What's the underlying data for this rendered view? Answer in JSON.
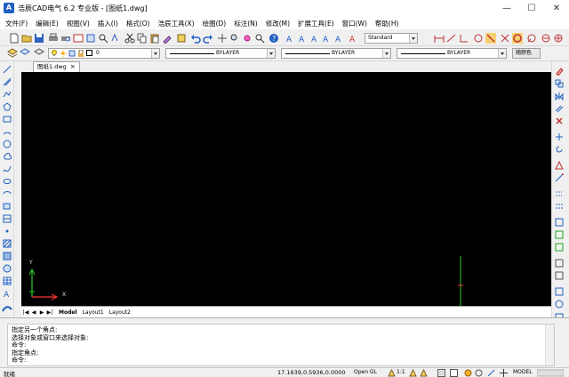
{
  "window": {
    "app_icon_label": "A",
    "title": "浩辰CAD电气 6.2 专业版 - [图纸1.dwg]",
    "minimize": "—",
    "maximize": "☐",
    "close": "✕"
  },
  "menu": [
    "文件(F)",
    "编辑(E)",
    "视图(V)",
    "插入(I)",
    "格式(O)",
    "浩辰工具(X)",
    "绘图(D)",
    "标注(N)",
    "修改(M)",
    "扩展工具(E)",
    "窗口(W)",
    "帮助(H)"
  ],
  "toolbar": {
    "text_style_value": "Standard",
    "layer_value": "0",
    "linetype_value": "BYLAYER",
    "lineweight_value": "BYLAYER",
    "color_value": "BYLAYER",
    "plot_style_value": "随颜色"
  },
  "document_tab": {
    "label": "图纸1.dwg",
    "close": "×"
  },
  "layout_tabs": {
    "nav_first": "|◀",
    "nav_prev": "◀",
    "nav_next": "▶",
    "nav_last": "▶|",
    "tabs": [
      "Model",
      "Layout1",
      "Layout2"
    ]
  },
  "canvas": {
    "ucs_y": "Y",
    "ucs_x": "X"
  },
  "command": {
    "lines": [
      "指定另一个角点:",
      "选择对象或窗口来选择对象:",
      "命令:",
      "指定角点:",
      "命令:"
    ]
  },
  "status": {
    "text": "就绪",
    "coordinates": "17.1639,0.5936,0.0000",
    "open_gl": "Open GL",
    "scale": "1:1",
    "mode": "MODEL"
  },
  "colors": {
    "canvas_background": "#000000",
    "ucs_green": "#33cc33",
    "ucs_red": "#ff3333",
    "accent_blue": "#1f5fbf"
  }
}
